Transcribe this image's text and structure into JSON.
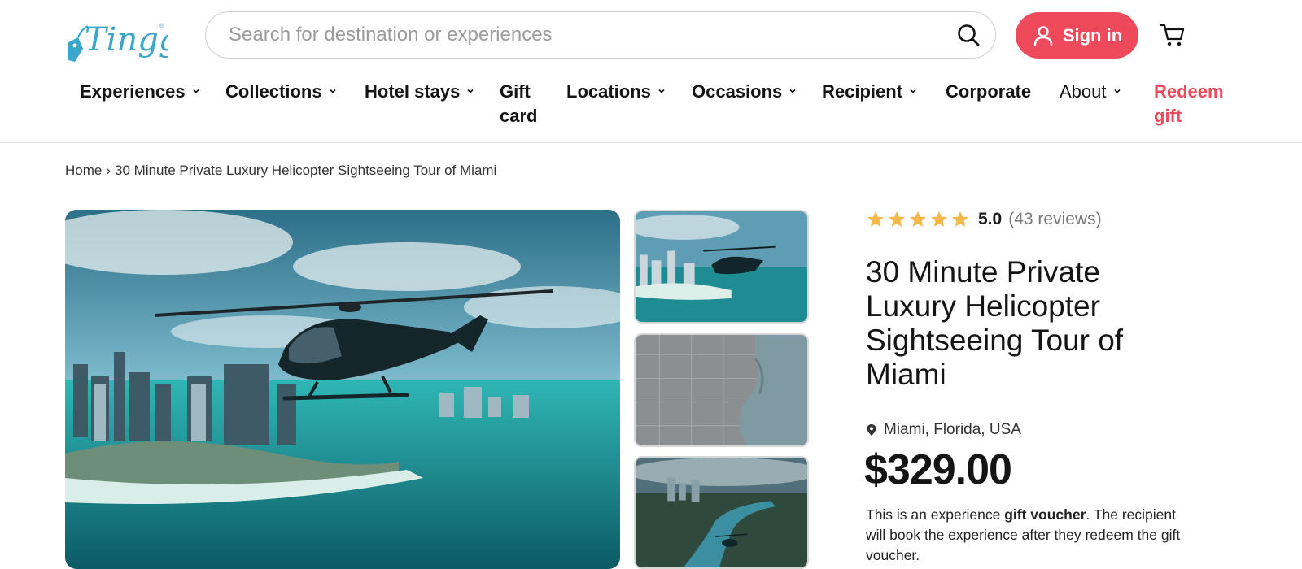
{
  "header": {
    "logo_text": "Tinggly",
    "search": {
      "placeholder": "Search for destination or experiences",
      "value": ""
    },
    "signin_label": "Sign in",
    "brand_color": "#ef4a5c",
    "logo_color": "#3aa6c9"
  },
  "nav": {
    "items": [
      {
        "label": "Experiences",
        "dropdown": true
      },
      {
        "label": "Collections",
        "dropdown": true
      },
      {
        "label": "Hotel stays",
        "dropdown": true
      },
      {
        "label": "Gift card",
        "dropdown": false
      },
      {
        "label": "Locations",
        "dropdown": true
      },
      {
        "label": "Occasions",
        "dropdown": true
      },
      {
        "label": "Recipient",
        "dropdown": true
      },
      {
        "label": "Corporate",
        "dropdown": false
      },
      {
        "label": "About",
        "dropdown": true
      },
      {
        "label": "Redeem gift",
        "dropdown": false
      }
    ]
  },
  "breadcrumb": {
    "home": "Home",
    "separator": "›",
    "current": "30 Minute Private Luxury Helicopter Sightseeing Tour of Miami"
  },
  "product": {
    "rating": {
      "stars": 5,
      "score": "5.0",
      "reviews": "(43 reviews)",
      "star_color": "#f6b84b"
    },
    "title": "30 Minute Private Luxury Helicopter Sightseeing Tour of Miami",
    "location": "Miami, Florida, USA",
    "price": "$329.00",
    "description": {
      "part1": "This is an experience ",
      "bold": "gift voucher",
      "part2": ". The recipient will book the experience after they redeem the gift voucher."
    }
  },
  "gallery": {
    "images": [
      "helicopter-over-miami-photo",
      "helicopter-over-miami-thumbnail",
      "miami-map-thumbnail",
      "helicopter-over-river-thumbnail"
    ]
  }
}
